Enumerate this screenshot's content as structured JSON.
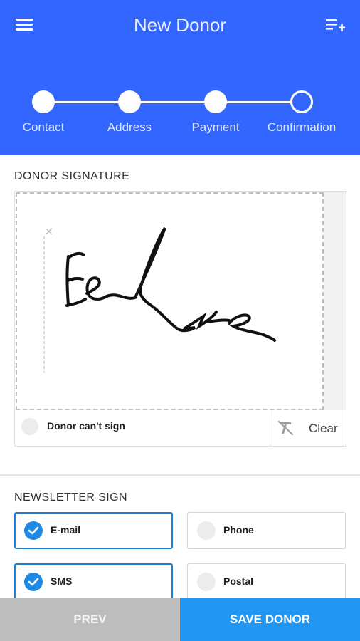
{
  "header": {
    "title": "New Donor",
    "accent_color": "#3366ff",
    "menu_icon": "menu-icon",
    "action_icon": "playlist-add-icon"
  },
  "stepper": {
    "steps": [
      {
        "label": "Contact",
        "state": "done"
      },
      {
        "label": "Address",
        "state": "done"
      },
      {
        "label": "Payment",
        "state": "done"
      },
      {
        "label": "Confirmation",
        "state": "current"
      }
    ]
  },
  "signature": {
    "section_title": "DONOR SIGNATURE",
    "cant_sign_label": "Donor can't sign",
    "cant_sign_checked": false,
    "clear_label": "Clear",
    "clear_icon": "clear-format-icon",
    "sign_here_mark": "×"
  },
  "newsletter": {
    "section_title": "NEWSLETTER SIGN",
    "options": [
      {
        "label": "E-mail",
        "selected": true
      },
      {
        "label": "Phone",
        "selected": false
      },
      {
        "label": "SMS",
        "selected": true
      },
      {
        "label": "Postal",
        "selected": false
      }
    ],
    "selected_color": "#1e88e5"
  },
  "footer": {
    "prev_label": "PREV",
    "save_label": "SAVE DONOR",
    "prev_color": "#bdbdbd",
    "save_color": "#2196f3"
  }
}
